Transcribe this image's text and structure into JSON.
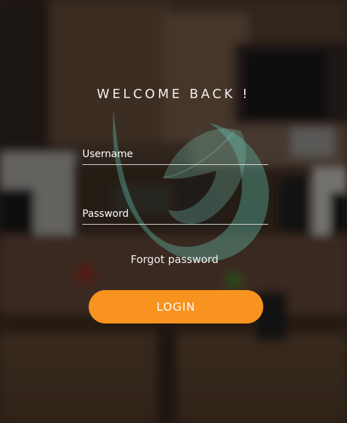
{
  "login": {
    "heading": "WELCOME BACK !",
    "username_placeholder": "Username",
    "password_placeholder": "Password",
    "forgot_label": "Forgot password",
    "submit_label": "LOGIN"
  },
  "icons": {
    "logo": "leaf-swirl-logo"
  },
  "colors": {
    "accent": "#f7931e",
    "logo_tint": "#5fb6a4",
    "text": "#ffffff"
  }
}
